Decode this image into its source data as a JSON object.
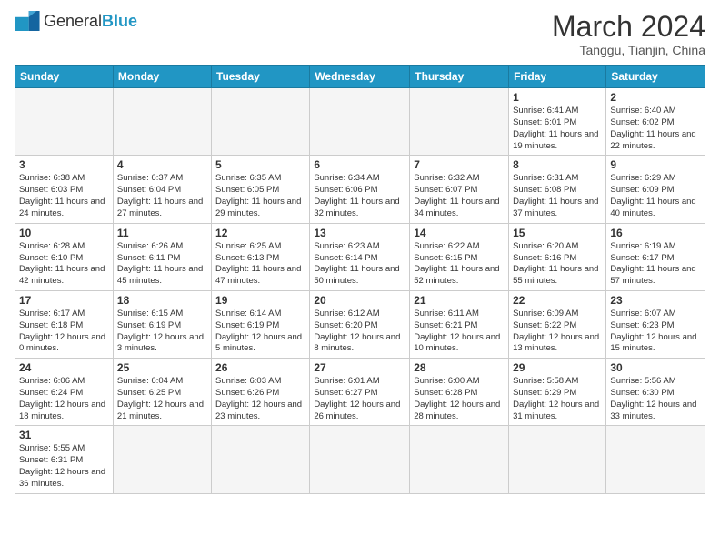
{
  "header": {
    "logo_general": "General",
    "logo_blue": "Blue",
    "month": "March 2024",
    "location": "Tanggu, Tianjin, China"
  },
  "weekdays": [
    "Sunday",
    "Monday",
    "Tuesday",
    "Wednesday",
    "Thursday",
    "Friday",
    "Saturday"
  ],
  "weeks": [
    [
      {
        "day": "",
        "info": ""
      },
      {
        "day": "",
        "info": ""
      },
      {
        "day": "",
        "info": ""
      },
      {
        "day": "",
        "info": ""
      },
      {
        "day": "",
        "info": ""
      },
      {
        "day": "1",
        "info": "Sunrise: 6:41 AM\nSunset: 6:01 PM\nDaylight: 11 hours and 19 minutes."
      },
      {
        "day": "2",
        "info": "Sunrise: 6:40 AM\nSunset: 6:02 PM\nDaylight: 11 hours and 22 minutes."
      }
    ],
    [
      {
        "day": "3",
        "info": "Sunrise: 6:38 AM\nSunset: 6:03 PM\nDaylight: 11 hours and 24 minutes."
      },
      {
        "day": "4",
        "info": "Sunrise: 6:37 AM\nSunset: 6:04 PM\nDaylight: 11 hours and 27 minutes."
      },
      {
        "day": "5",
        "info": "Sunrise: 6:35 AM\nSunset: 6:05 PM\nDaylight: 11 hours and 29 minutes."
      },
      {
        "day": "6",
        "info": "Sunrise: 6:34 AM\nSunset: 6:06 PM\nDaylight: 11 hours and 32 minutes."
      },
      {
        "day": "7",
        "info": "Sunrise: 6:32 AM\nSunset: 6:07 PM\nDaylight: 11 hours and 34 minutes."
      },
      {
        "day": "8",
        "info": "Sunrise: 6:31 AM\nSunset: 6:08 PM\nDaylight: 11 hours and 37 minutes."
      },
      {
        "day": "9",
        "info": "Sunrise: 6:29 AM\nSunset: 6:09 PM\nDaylight: 11 hours and 40 minutes."
      }
    ],
    [
      {
        "day": "10",
        "info": "Sunrise: 6:28 AM\nSunset: 6:10 PM\nDaylight: 11 hours and 42 minutes."
      },
      {
        "day": "11",
        "info": "Sunrise: 6:26 AM\nSunset: 6:11 PM\nDaylight: 11 hours and 45 minutes."
      },
      {
        "day": "12",
        "info": "Sunrise: 6:25 AM\nSunset: 6:13 PM\nDaylight: 11 hours and 47 minutes."
      },
      {
        "day": "13",
        "info": "Sunrise: 6:23 AM\nSunset: 6:14 PM\nDaylight: 11 hours and 50 minutes."
      },
      {
        "day": "14",
        "info": "Sunrise: 6:22 AM\nSunset: 6:15 PM\nDaylight: 11 hours and 52 minutes."
      },
      {
        "day": "15",
        "info": "Sunrise: 6:20 AM\nSunset: 6:16 PM\nDaylight: 11 hours and 55 minutes."
      },
      {
        "day": "16",
        "info": "Sunrise: 6:19 AM\nSunset: 6:17 PM\nDaylight: 11 hours and 57 minutes."
      }
    ],
    [
      {
        "day": "17",
        "info": "Sunrise: 6:17 AM\nSunset: 6:18 PM\nDaylight: 12 hours and 0 minutes."
      },
      {
        "day": "18",
        "info": "Sunrise: 6:15 AM\nSunset: 6:19 PM\nDaylight: 12 hours and 3 minutes."
      },
      {
        "day": "19",
        "info": "Sunrise: 6:14 AM\nSunset: 6:19 PM\nDaylight: 12 hours and 5 minutes."
      },
      {
        "day": "20",
        "info": "Sunrise: 6:12 AM\nSunset: 6:20 PM\nDaylight: 12 hours and 8 minutes."
      },
      {
        "day": "21",
        "info": "Sunrise: 6:11 AM\nSunset: 6:21 PM\nDaylight: 12 hours and 10 minutes."
      },
      {
        "day": "22",
        "info": "Sunrise: 6:09 AM\nSunset: 6:22 PM\nDaylight: 12 hours and 13 minutes."
      },
      {
        "day": "23",
        "info": "Sunrise: 6:07 AM\nSunset: 6:23 PM\nDaylight: 12 hours and 15 minutes."
      }
    ],
    [
      {
        "day": "24",
        "info": "Sunrise: 6:06 AM\nSunset: 6:24 PM\nDaylight: 12 hours and 18 minutes."
      },
      {
        "day": "25",
        "info": "Sunrise: 6:04 AM\nSunset: 6:25 PM\nDaylight: 12 hours and 21 minutes."
      },
      {
        "day": "26",
        "info": "Sunrise: 6:03 AM\nSunset: 6:26 PM\nDaylight: 12 hours and 23 minutes."
      },
      {
        "day": "27",
        "info": "Sunrise: 6:01 AM\nSunset: 6:27 PM\nDaylight: 12 hours and 26 minutes."
      },
      {
        "day": "28",
        "info": "Sunrise: 6:00 AM\nSunset: 6:28 PM\nDaylight: 12 hours and 28 minutes."
      },
      {
        "day": "29",
        "info": "Sunrise: 5:58 AM\nSunset: 6:29 PM\nDaylight: 12 hours and 31 minutes."
      },
      {
        "day": "30",
        "info": "Sunrise: 5:56 AM\nSunset: 6:30 PM\nDaylight: 12 hours and 33 minutes."
      }
    ],
    [
      {
        "day": "31",
        "info": "Sunrise: 5:55 AM\nSunset: 6:31 PM\nDaylight: 12 hours and 36 minutes."
      },
      {
        "day": "",
        "info": ""
      },
      {
        "day": "",
        "info": ""
      },
      {
        "day": "",
        "info": ""
      },
      {
        "day": "",
        "info": ""
      },
      {
        "day": "",
        "info": ""
      },
      {
        "day": "",
        "info": ""
      }
    ]
  ]
}
